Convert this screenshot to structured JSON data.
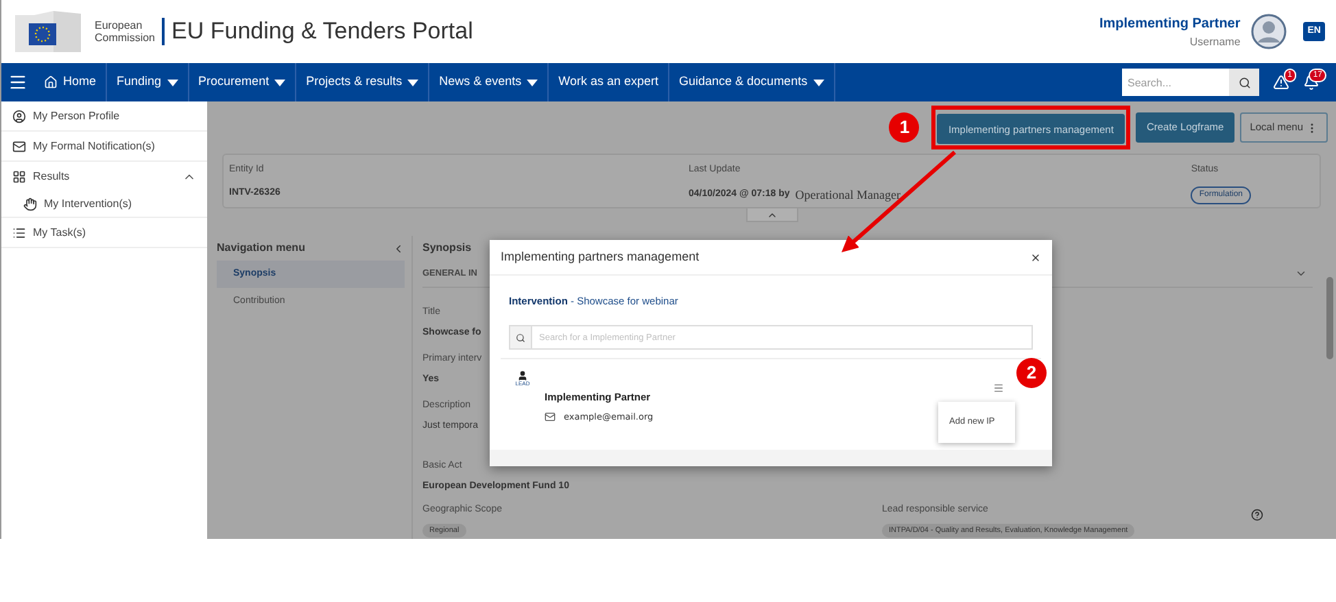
{
  "header": {
    "org_line1": "European",
    "org_line2": "Commission",
    "portal_title": "EU Funding & Tenders Portal",
    "user_role": "Implementing Partner",
    "username": "Username",
    "language": "EN"
  },
  "nav": {
    "items": [
      {
        "label": "Home",
        "kind": "home"
      },
      {
        "label": "Funding",
        "kind": "dropdown"
      },
      {
        "label": "Procurement",
        "kind": "dropdown"
      },
      {
        "label": "Projects & results",
        "kind": "dropdown"
      },
      {
        "label": "News & events",
        "kind": "dropdown"
      },
      {
        "label": "Work as an expert",
        "kind": "plain"
      },
      {
        "label": "Guidance & documents",
        "kind": "dropdown"
      }
    ],
    "search_placeholder": "Search...",
    "alerts_count": "1",
    "notifications_count": "17"
  },
  "sidebar": {
    "items": [
      {
        "label": "My Person Profile",
        "kind": "profile"
      },
      {
        "label": "My Formal Notification(s)",
        "kind": "mail"
      },
      {
        "label": "Results",
        "kind": "grid",
        "expanded": true,
        "children": [
          {
            "label": "My Intervention(s)",
            "kind": "hand"
          }
        ]
      },
      {
        "label": "My Task(s)",
        "kind": "list"
      }
    ]
  },
  "toolbar": {
    "buttons": [
      {
        "label": "Implementing partners management",
        "kind": "primary",
        "highlighted": true
      },
      {
        "label": "Create Logframe",
        "kind": "primary",
        "highlighted": false
      },
      {
        "label": "Local menu",
        "kind": "outline",
        "highlighted": false
      }
    ]
  },
  "entity": {
    "fields": [
      {
        "label": "Entity Id",
        "value": "INTV-26326",
        "kind": "text"
      },
      {
        "label": "Last Update",
        "value": "04/10/2024 @ 07:18 by",
        "extra": "Operational Manager",
        "kind": "update"
      },
      {
        "label": "Status",
        "value": "Formulation",
        "kind": "pill"
      }
    ]
  },
  "navigation_menu": {
    "title": "Navigation menu",
    "items": [
      {
        "label": "Synopsis",
        "selected": true
      },
      {
        "label": "Contribution",
        "selected": false
      }
    ]
  },
  "synopsis": {
    "title": "Synopsis",
    "section": "GENERAL IN",
    "fields": [
      {
        "label": "Title",
        "value": "Showcase fo",
        "plain": false
      },
      {
        "label": "Primary interv",
        "value": "Yes",
        "plain": false
      },
      {
        "label": "Description",
        "value": "Just tempora",
        "plain": true
      },
      {
        "label": "Basic Act",
        "value": "European Development Fund 10",
        "plain": false
      }
    ],
    "row_fields": [
      {
        "label": "Geographic Scope",
        "value": "Regional"
      },
      {
        "label": "Lead responsible service",
        "value": "INTPA/D/04 - Quality and Results, Evaluation, Knowledge Management"
      }
    ]
  },
  "modal": {
    "title": "Implementing partners management",
    "context": "**Intervention** - Showcase for webinar",
    "search_placeholder": "Search for a Implementing Partner",
    "partners": [
      {
        "badge": "LEAD",
        "name": "Implementing Partner",
        "email": "example@email.org"
      }
    ],
    "menu_items": [
      "Add new IP"
    ]
  },
  "annotations": [
    {
      "label": "1"
    },
    {
      "label": "2"
    }
  ]
}
